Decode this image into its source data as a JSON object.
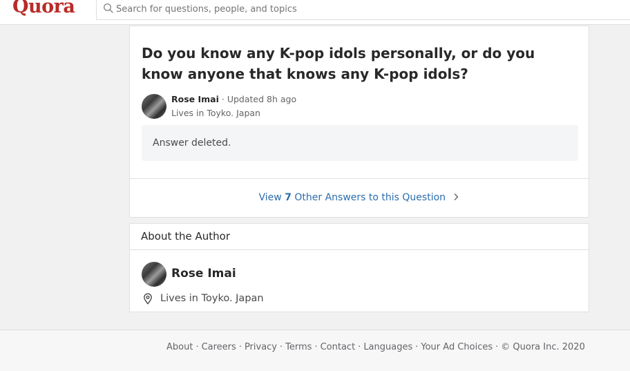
{
  "header": {
    "logo": "Quora",
    "search_placeholder": "Search for questions, people, and topics"
  },
  "question": {
    "title": "Do you know any K-pop idols personally, or do you know anyone that knows any K-pop idols?",
    "author_name": "Rose Imai",
    "updated": "· Updated 8h ago",
    "credential": "Lives in Toyko. Japan",
    "answer_text": "Answer deleted.",
    "view_prefix": "View",
    "other_count": "7",
    "view_suffix": "Other Answers to this Question"
  },
  "about": {
    "header": "About the Author",
    "name": "Rose Imai",
    "location": "Lives in Toyko. Japan"
  },
  "footer": {
    "links": [
      "About",
      "Careers",
      "Privacy",
      "Terms",
      "Contact",
      "Languages",
      "Your Ad Choices"
    ],
    "copyright": "© Quora Inc. 2020"
  },
  "colors": {
    "brand": "#b92b27",
    "link": "#2b6dad",
    "background": "#f1f1f2"
  }
}
